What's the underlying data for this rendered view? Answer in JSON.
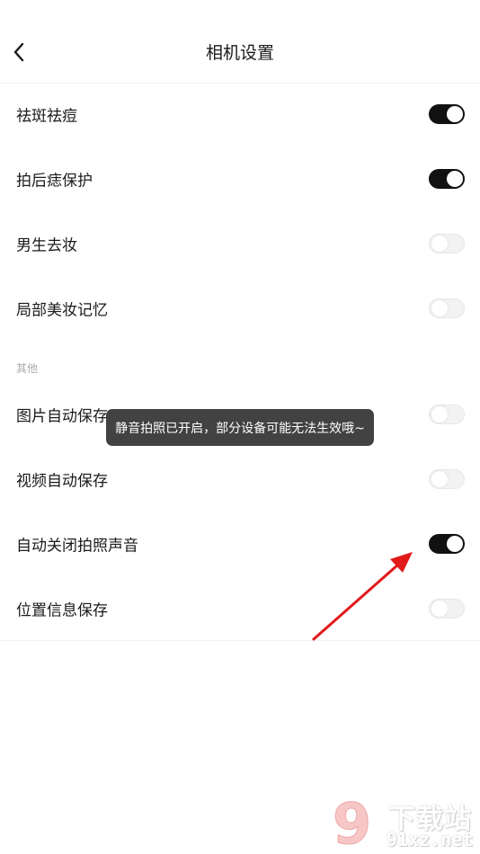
{
  "header": {
    "title": "相机设置",
    "back_icon": "chevron-left-icon"
  },
  "settings": [
    {
      "label": "祛斑祛痘",
      "enabled": true
    },
    {
      "label": "拍后痣保护",
      "enabled": true
    },
    {
      "label": "男生去妆",
      "enabled": false
    },
    {
      "label": "局部美妆记忆",
      "enabled": false
    }
  ],
  "section_other": {
    "label": "其他",
    "items": [
      {
        "label": "图片自动保存",
        "enabled": false
      },
      {
        "label": "视频自动保存",
        "enabled": false
      },
      {
        "label": "自动关闭拍照声音",
        "enabled": true
      },
      {
        "label": "位置信息保存",
        "enabled": false
      }
    ]
  },
  "toast": {
    "text": "静音拍照已开启，部分设备可能无法生效哦~"
  },
  "watermark": {
    "logo_text": "9",
    "cn_text": "下载站",
    "en_text": "91xz.net"
  },
  "colors": {
    "toggle_on": "#111111",
    "toggle_off": "#f2f2f2",
    "annotation_arrow": "#e0191b"
  }
}
